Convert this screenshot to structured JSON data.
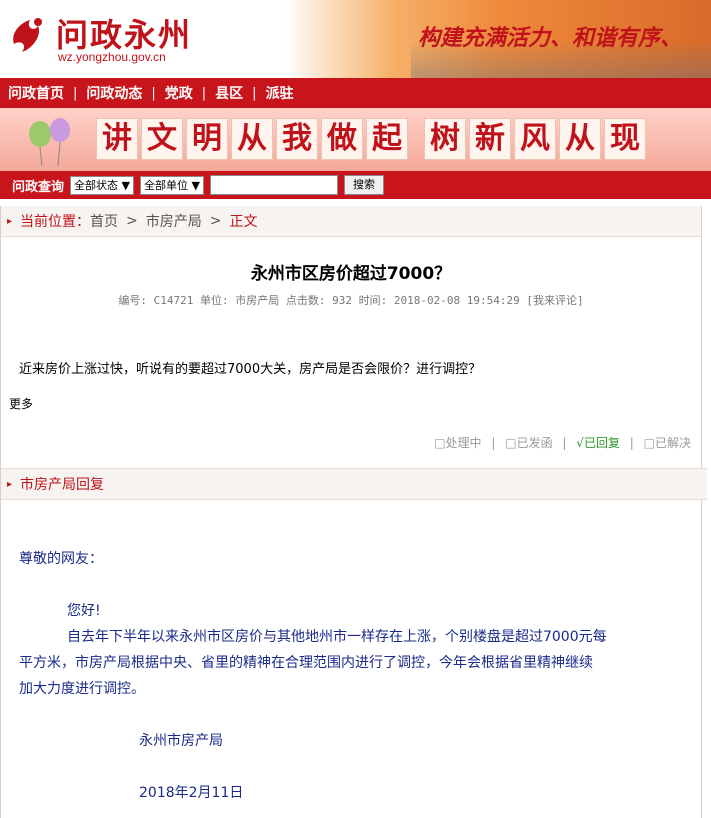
{
  "banner": {
    "logo_text": "问政永州",
    "logo_url": "wz.yongzhou.gov.cn",
    "slogan": "构建充满活力、和谐有序、"
  },
  "nav": {
    "items": [
      "问政首页",
      "问政动态",
      "党政",
      "县区",
      "派驻"
    ]
  },
  "band": {
    "chars1": [
      "讲",
      "文",
      "明",
      "从",
      "我",
      "做",
      "起"
    ],
    "chars2": [
      "树",
      "新",
      "风",
      "从",
      "现"
    ]
  },
  "search": {
    "label": "问政查询",
    "status_select": "全部状态 ▼",
    "unit_select": "全部单位 ▼",
    "input_value": "",
    "button": "搜索"
  },
  "breadcrumb": {
    "label": "当前位置：",
    "home": "首页",
    "dept": "市房产局",
    "current": "正文",
    "sep": ">"
  },
  "post": {
    "title": "永州市区房价超过7000？",
    "meta": "编号: C14721 单位: 市房产局 点击数: 932 时间: 2018-02-08 19:54:29",
    "comment_link": "[我来评论]",
    "question": "近来房价上涨过快，听说有的要超过7000大关，房产局是否会限价？进行调控？",
    "more": "更多"
  },
  "status": {
    "processing": "□处理中",
    "sent": "□已发函",
    "replied": "√已回复",
    "resolved": "□已解决",
    "sep": "|"
  },
  "reply": {
    "header": "市房产局回复",
    "greeting": "尊敬的网友：",
    "hello": "您好!",
    "body_line1": "自去年下半年以来永州市区房价与其他地州市一样存在上涨，个别楼盘是超过7000元每",
    "body_line2": "平方米，市房产局根据中央、省里的精神在合理范围内进行了调控，今年会根据省里精神继续",
    "body_line3": "加大力度进行调控。",
    "signature": "永州市房产局",
    "date": "2018年2月11日"
  },
  "colors": {
    "brand_red": "#c8151b",
    "reply_blue": "#1a2a8a",
    "status_green": "#2a9a2a"
  }
}
